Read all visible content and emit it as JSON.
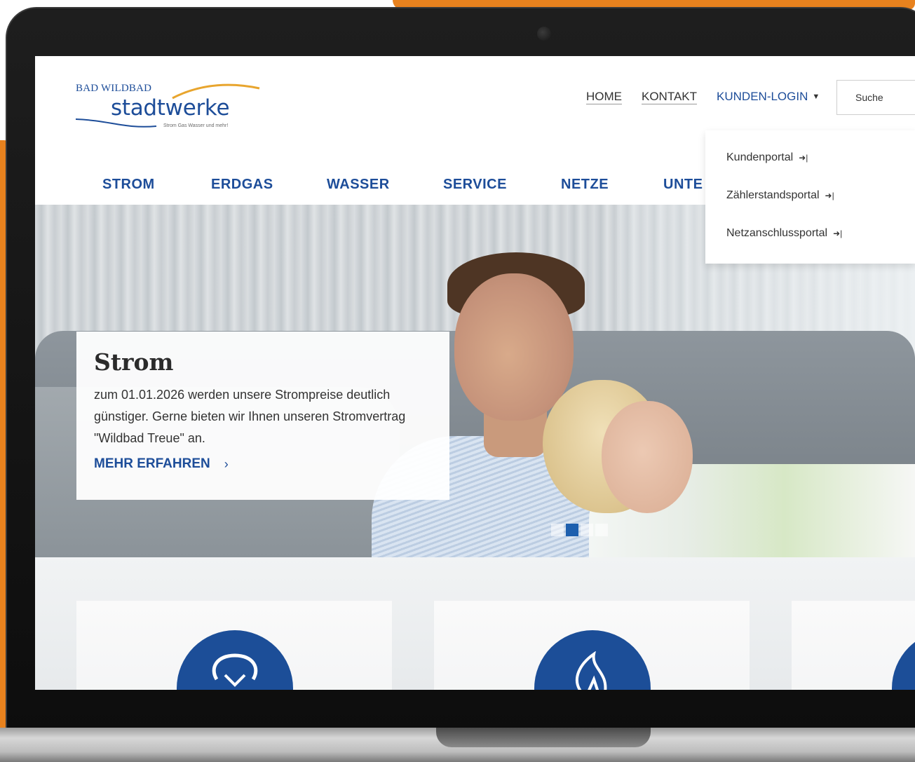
{
  "logo": {
    "top_text": "BAD WILDBAD",
    "main_text": "stadtwerke",
    "tagline": "Strom Gas Wasser und mehr!"
  },
  "topnav": {
    "home": "HOME",
    "kontakt": "KONTAKT",
    "kunden_login": "KUNDEN-LOGIN",
    "caret_icon": "caret-down-icon"
  },
  "search": {
    "placeholder": "Suche"
  },
  "mainnav": {
    "items": [
      "STROM",
      "ERDGAS",
      "WASSER",
      "SERVICE",
      "NETZE",
      "UNTE"
    ]
  },
  "dropdown": {
    "items": [
      {
        "label": "Kundenportal",
        "icon": "sign-in-icon"
      },
      {
        "label": "Zählerstandsportal",
        "icon": "sign-in-icon"
      },
      {
        "label": "Netzanschlussportal",
        "icon": "sign-in-icon"
      }
    ]
  },
  "hero": {
    "title": "Strom",
    "text": "zum 01.01.2026 werden unsere Strompreise deutlich günstiger.  Gerne bieten wir Ihnen unseren Stromvertrag \"Wildbad Treue\" an.",
    "link_label": "MEHR ERFAHREN",
    "link_chevron": "›",
    "slides_total": 4,
    "active_slide": 2
  },
  "tiles": [
    {
      "icon": "lightbulb-icon"
    },
    {
      "icon": "flame-icon"
    },
    {
      "icon": "circle-icon"
    }
  ],
  "colors": {
    "brand_blue": "#1d4d99",
    "accent_orange": "#e8821e",
    "slide_active": "#1d5fae"
  }
}
